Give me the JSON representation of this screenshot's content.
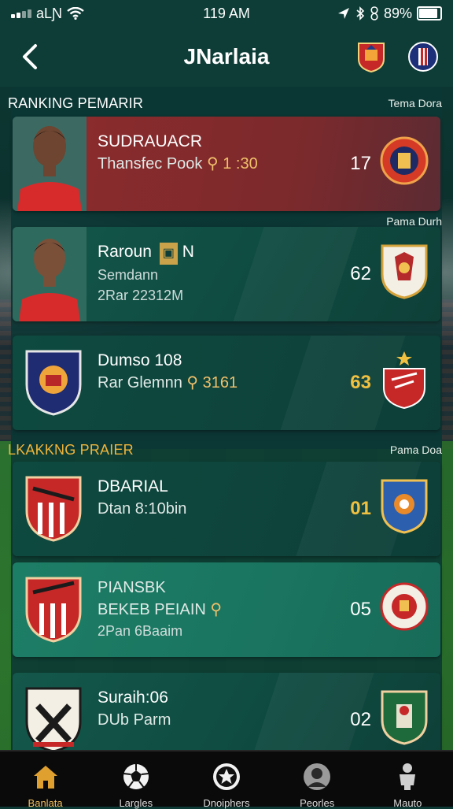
{
  "status_bar": {
    "carrier": "aLƝ",
    "time": "119 AM",
    "battery_text": "89%",
    "battery_level": 0.89
  },
  "header": {
    "title": "JNarlaia",
    "back_icon": "chevron-left-icon"
  },
  "sections": [
    {
      "title": "RANKING PEMARIR",
      "right": "Tema Dora",
      "title_color": "#ffffff"
    },
    {
      "title": "Pama Durh",
      "right": ""
    },
    {
      "title": "LKAKKNG PRAIER",
      "right": "Pama Doa",
      "title_color": "#f0b43a"
    }
  ],
  "cards": [
    {
      "line1": "SUDRAUACR",
      "line2": "Thansfec Pook",
      "line2_extra": "1 :30",
      "score": "17",
      "variant": "red"
    },
    {
      "line1": "Raroun",
      "line1_badge": "N",
      "line2": "Semdann",
      "line3": "2Rar 22312M",
      "score": "62",
      "variant": "default"
    },
    {
      "line1": "Dumso 108",
      "line2": "Rar Glemnn",
      "line2_extra": "3161",
      "score": "63",
      "score_color": "#f0c040",
      "variant": "darker"
    },
    {
      "line1": "DBARIAL",
      "line2": "Dtan 8:10bin",
      "score": "01",
      "score_color": "#f0c040",
      "variant": "darker"
    },
    {
      "line1": "PIANSBK",
      "line2": "BEKEB PEIAIN",
      "line3": "2Pan 6Baaim",
      "score": "05",
      "variant": "bright"
    },
    {
      "line1": "Suraih:06",
      "line2": "DUb Parm",
      "score": "02",
      "variant": "default"
    }
  ],
  "tabs": [
    {
      "label": "Banlata",
      "icon": "home-icon",
      "active": true
    },
    {
      "label": "Largles",
      "icon": "ball-icon",
      "active": false
    },
    {
      "label": "Dnoiphers",
      "icon": "star-badge-icon",
      "active": false
    },
    {
      "label": "Peorles",
      "icon": "profile-icon",
      "active": false
    },
    {
      "label": "Mauto",
      "icon": "trophy-icon",
      "active": false
    }
  ]
}
